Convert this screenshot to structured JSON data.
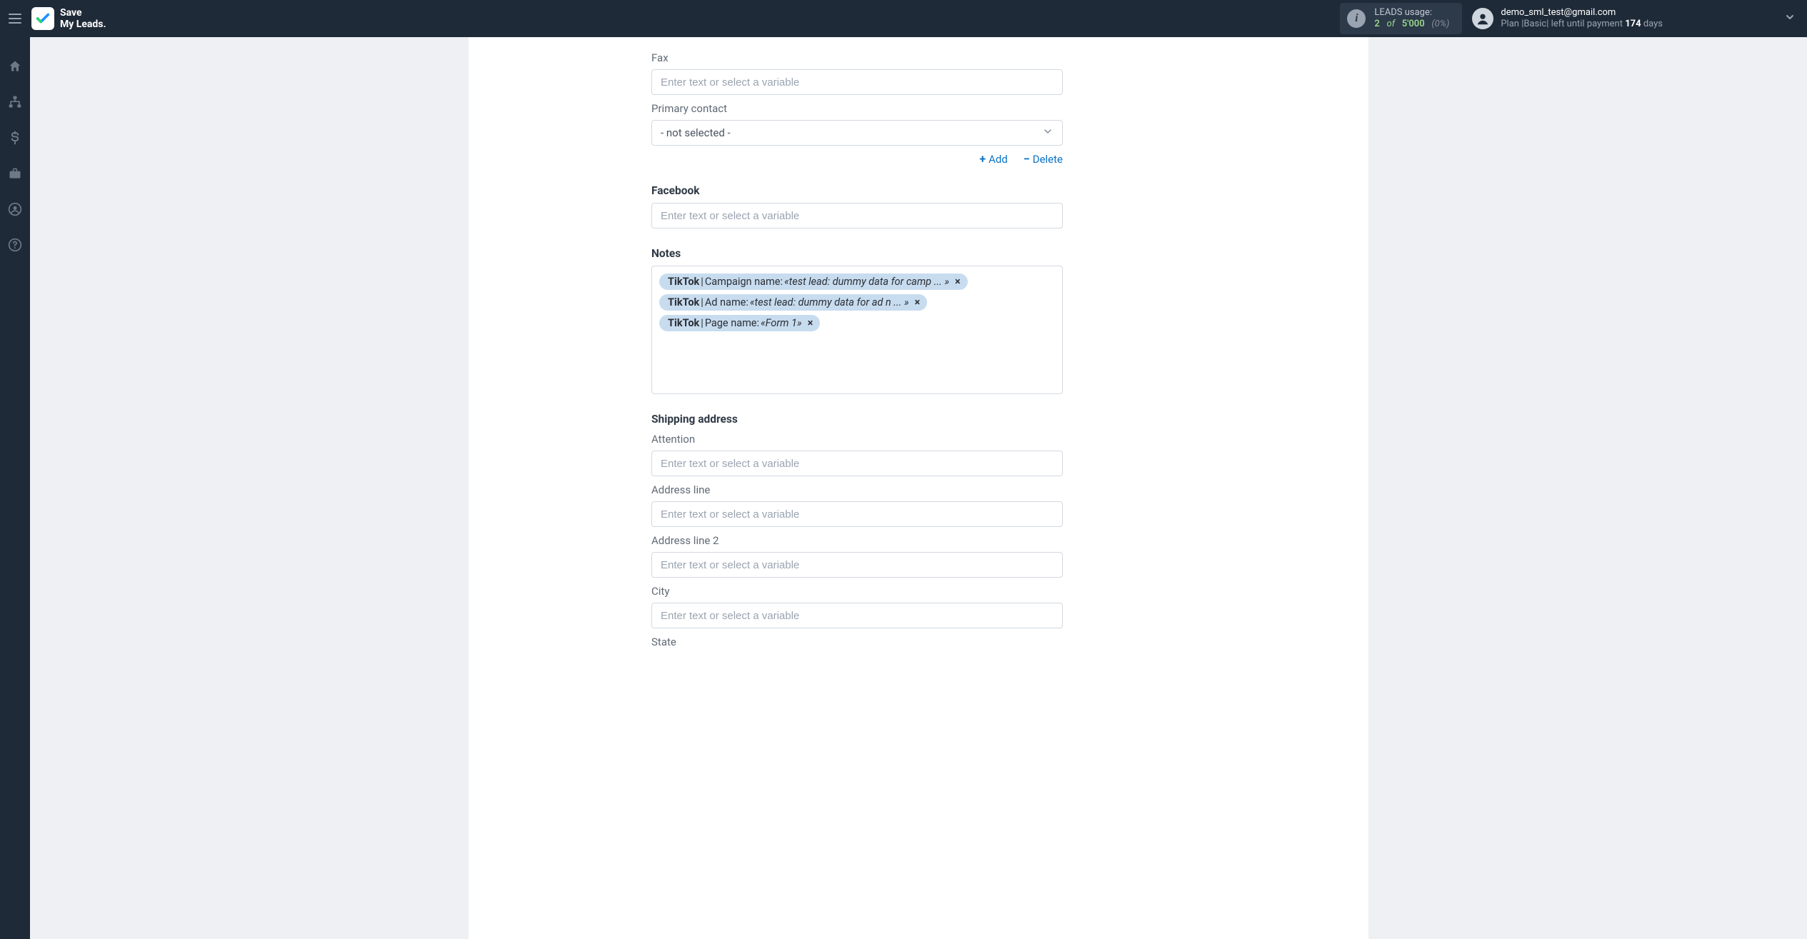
{
  "brand": {
    "line1": "Save",
    "line2": "My Leads."
  },
  "leads_usage": {
    "title": "LEADS usage:",
    "used": "2",
    "of_word": "of",
    "total": "5'000",
    "pct": "(0%)"
  },
  "account": {
    "email": "demo_sml_test@gmail.com",
    "plan_prefix": "Plan |Basic| left until payment ",
    "days": "174",
    "days_suffix": " days"
  },
  "sidebar": {
    "items": [
      {
        "name": "home-icon"
      },
      {
        "name": "sitemap-icon"
      },
      {
        "name": "dollar-icon"
      },
      {
        "name": "briefcase-icon"
      },
      {
        "name": "user-circle-icon"
      },
      {
        "name": "question-circle-icon"
      }
    ]
  },
  "form": {
    "placeholder": "Enter text or select a variable",
    "fax_label": "Fax",
    "primary_contact_label": "Primary contact",
    "primary_contact_value": "- not selected -",
    "actions": {
      "add": "Add",
      "delete": "Delete"
    },
    "facebook_label": "Facebook",
    "notes_label": "Notes",
    "notes_tags": [
      {
        "source": "TikTok",
        "label": "Campaign name:",
        "value": "«test lead: dummy data for camp ... »"
      },
      {
        "source": "TikTok",
        "label": "Ad name:",
        "value": "«test lead: dummy data for ad n ... »"
      },
      {
        "source": "TikTok",
        "label": "Page name:",
        "value": "«Form 1»"
      }
    ],
    "shipping_section": "Shipping address",
    "attention_label": "Attention",
    "address1_label": "Address line",
    "address2_label": "Address line 2",
    "city_label": "City",
    "state_label": "State"
  }
}
